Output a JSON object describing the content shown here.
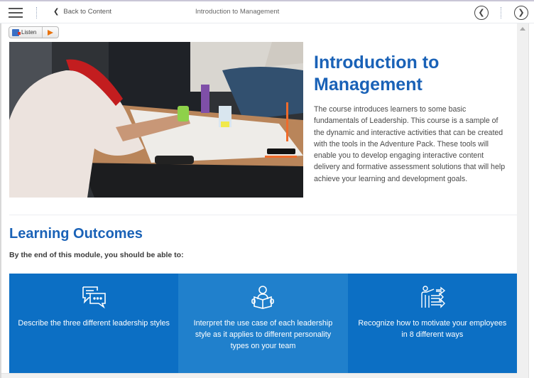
{
  "topbar": {
    "back_label": "Back to Content",
    "title": "Introduction to Management",
    "prev_icon": "chevron-left-circle-icon",
    "next_icon": "chevron-right-circle-icon",
    "menu_icon": "hamburger-menu-icon"
  },
  "listen": {
    "label": "Listen",
    "play_icon": "play-icon"
  },
  "hero": {
    "image_alt": "Students collaborating around a table with markers and paper",
    "title": "Introduction to Management",
    "description": "The course introduces learners to some basic fundamentals of Leadership. This course is a sample of the dynamic and interactive activities that can be created with the tools in the Adventure Pack. These tools will enable you to develop engaging interactive content delivery and formative assessment solutions that will help achieve your learning and development goals."
  },
  "learning_outcomes": {
    "title": "Learning Outcomes",
    "subtitle": "By the end of this module, you should be able to:",
    "items": [
      {
        "icon": "chat-bubbles-icon",
        "text": "Describe the three different leadership styles"
      },
      {
        "icon": "person-reading-icon",
        "text": "Interpret the use case of each leadership style as it applies to different personality types on your team"
      },
      {
        "icon": "presenter-arrows-icon",
        "text": "Recognize how to motivate your employees in 8 different ways"
      }
    ]
  },
  "colors": {
    "accent": "#1a62b7",
    "card_dark": "#0c6fc4",
    "card_light": "#2080cc",
    "play": "#e8720c"
  }
}
